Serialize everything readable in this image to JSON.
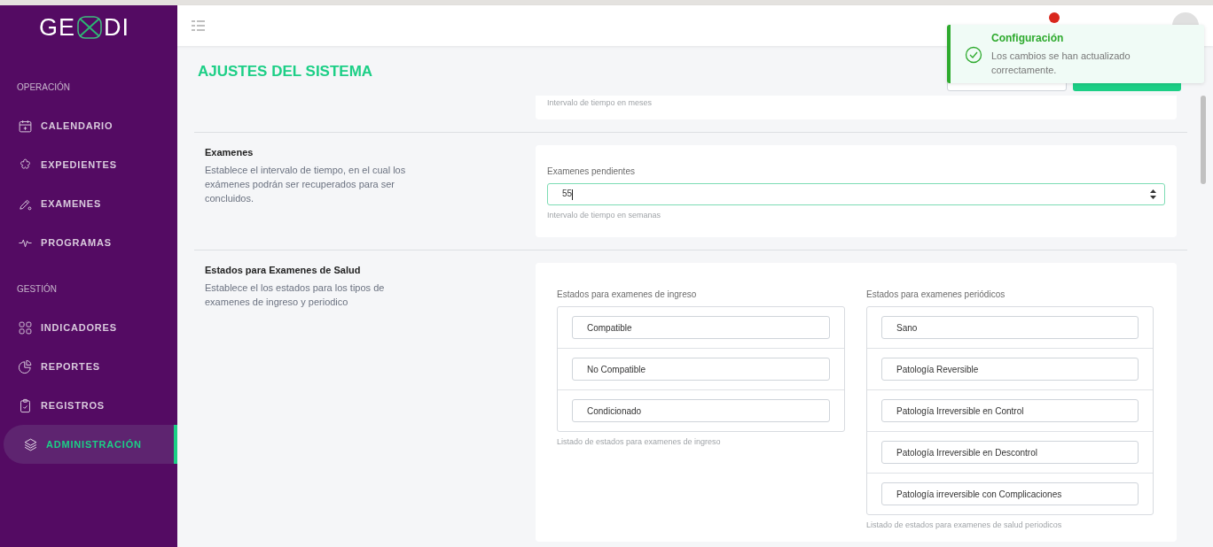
{
  "logo": {
    "text_left": "GE",
    "text_right": "DI"
  },
  "sidebar": {
    "groups": [
      {
        "heading": "OPERACIÓN",
        "items": [
          {
            "label": "CALENDARIO",
            "selected": false
          },
          {
            "label": "EXPEDIENTES",
            "selected": false
          },
          {
            "label": "EXAMENES",
            "selected": false
          },
          {
            "label": "PROGRAMAS",
            "selected": false
          }
        ]
      },
      {
        "heading": "GESTIÓN",
        "items": [
          {
            "label": "INDICADORES",
            "selected": false
          },
          {
            "label": "REPORTES",
            "selected": false
          },
          {
            "label": "REGISTROS",
            "selected": false
          },
          {
            "label": "ADMINISTRACIÓN",
            "selected": true
          }
        ]
      }
    ]
  },
  "page": {
    "title": "AJUSTES DEL SISTEMA"
  },
  "sections": [
    {
      "kind": "partial",
      "hint": "Intervalo de tiempo en meses"
    },
    {
      "kind": "number",
      "title": "Examenes",
      "description": "Establece el intervalo de tiempo, en el cual los exámenes podrán ser recuperados para ser concluidos.",
      "label": "Examenes pendientes",
      "value": "55",
      "focused": true,
      "hint": "Intervalo de tiempo en semanas"
    },
    {
      "kind": "lists",
      "title": "Estados para Examenes de Salud",
      "description": "Establece el los estados para los tipos de examenes de ingreso y periodico",
      "lists": [
        {
          "label": "Estados para examenes de ingreso",
          "items": [
            "Compatible",
            "No Compatible",
            "Condicionado"
          ],
          "hint": "Listado de estados para examenes de ingreso"
        },
        {
          "label": "Estados para examenes periódicos",
          "items": [
            "Sano",
            "Patología Reversible",
            "Patología Irreversible en Control",
            "Patología Irreversible en Descontrol",
            "Patología irreversible con Complicaciones"
          ],
          "hint": "Listado de estados para examenes de salud periodicos"
        }
      ]
    }
  ],
  "toast": {
    "kind": "success",
    "title": "Configuración",
    "message": "Los cambios se han actualizado correctamente."
  }
}
